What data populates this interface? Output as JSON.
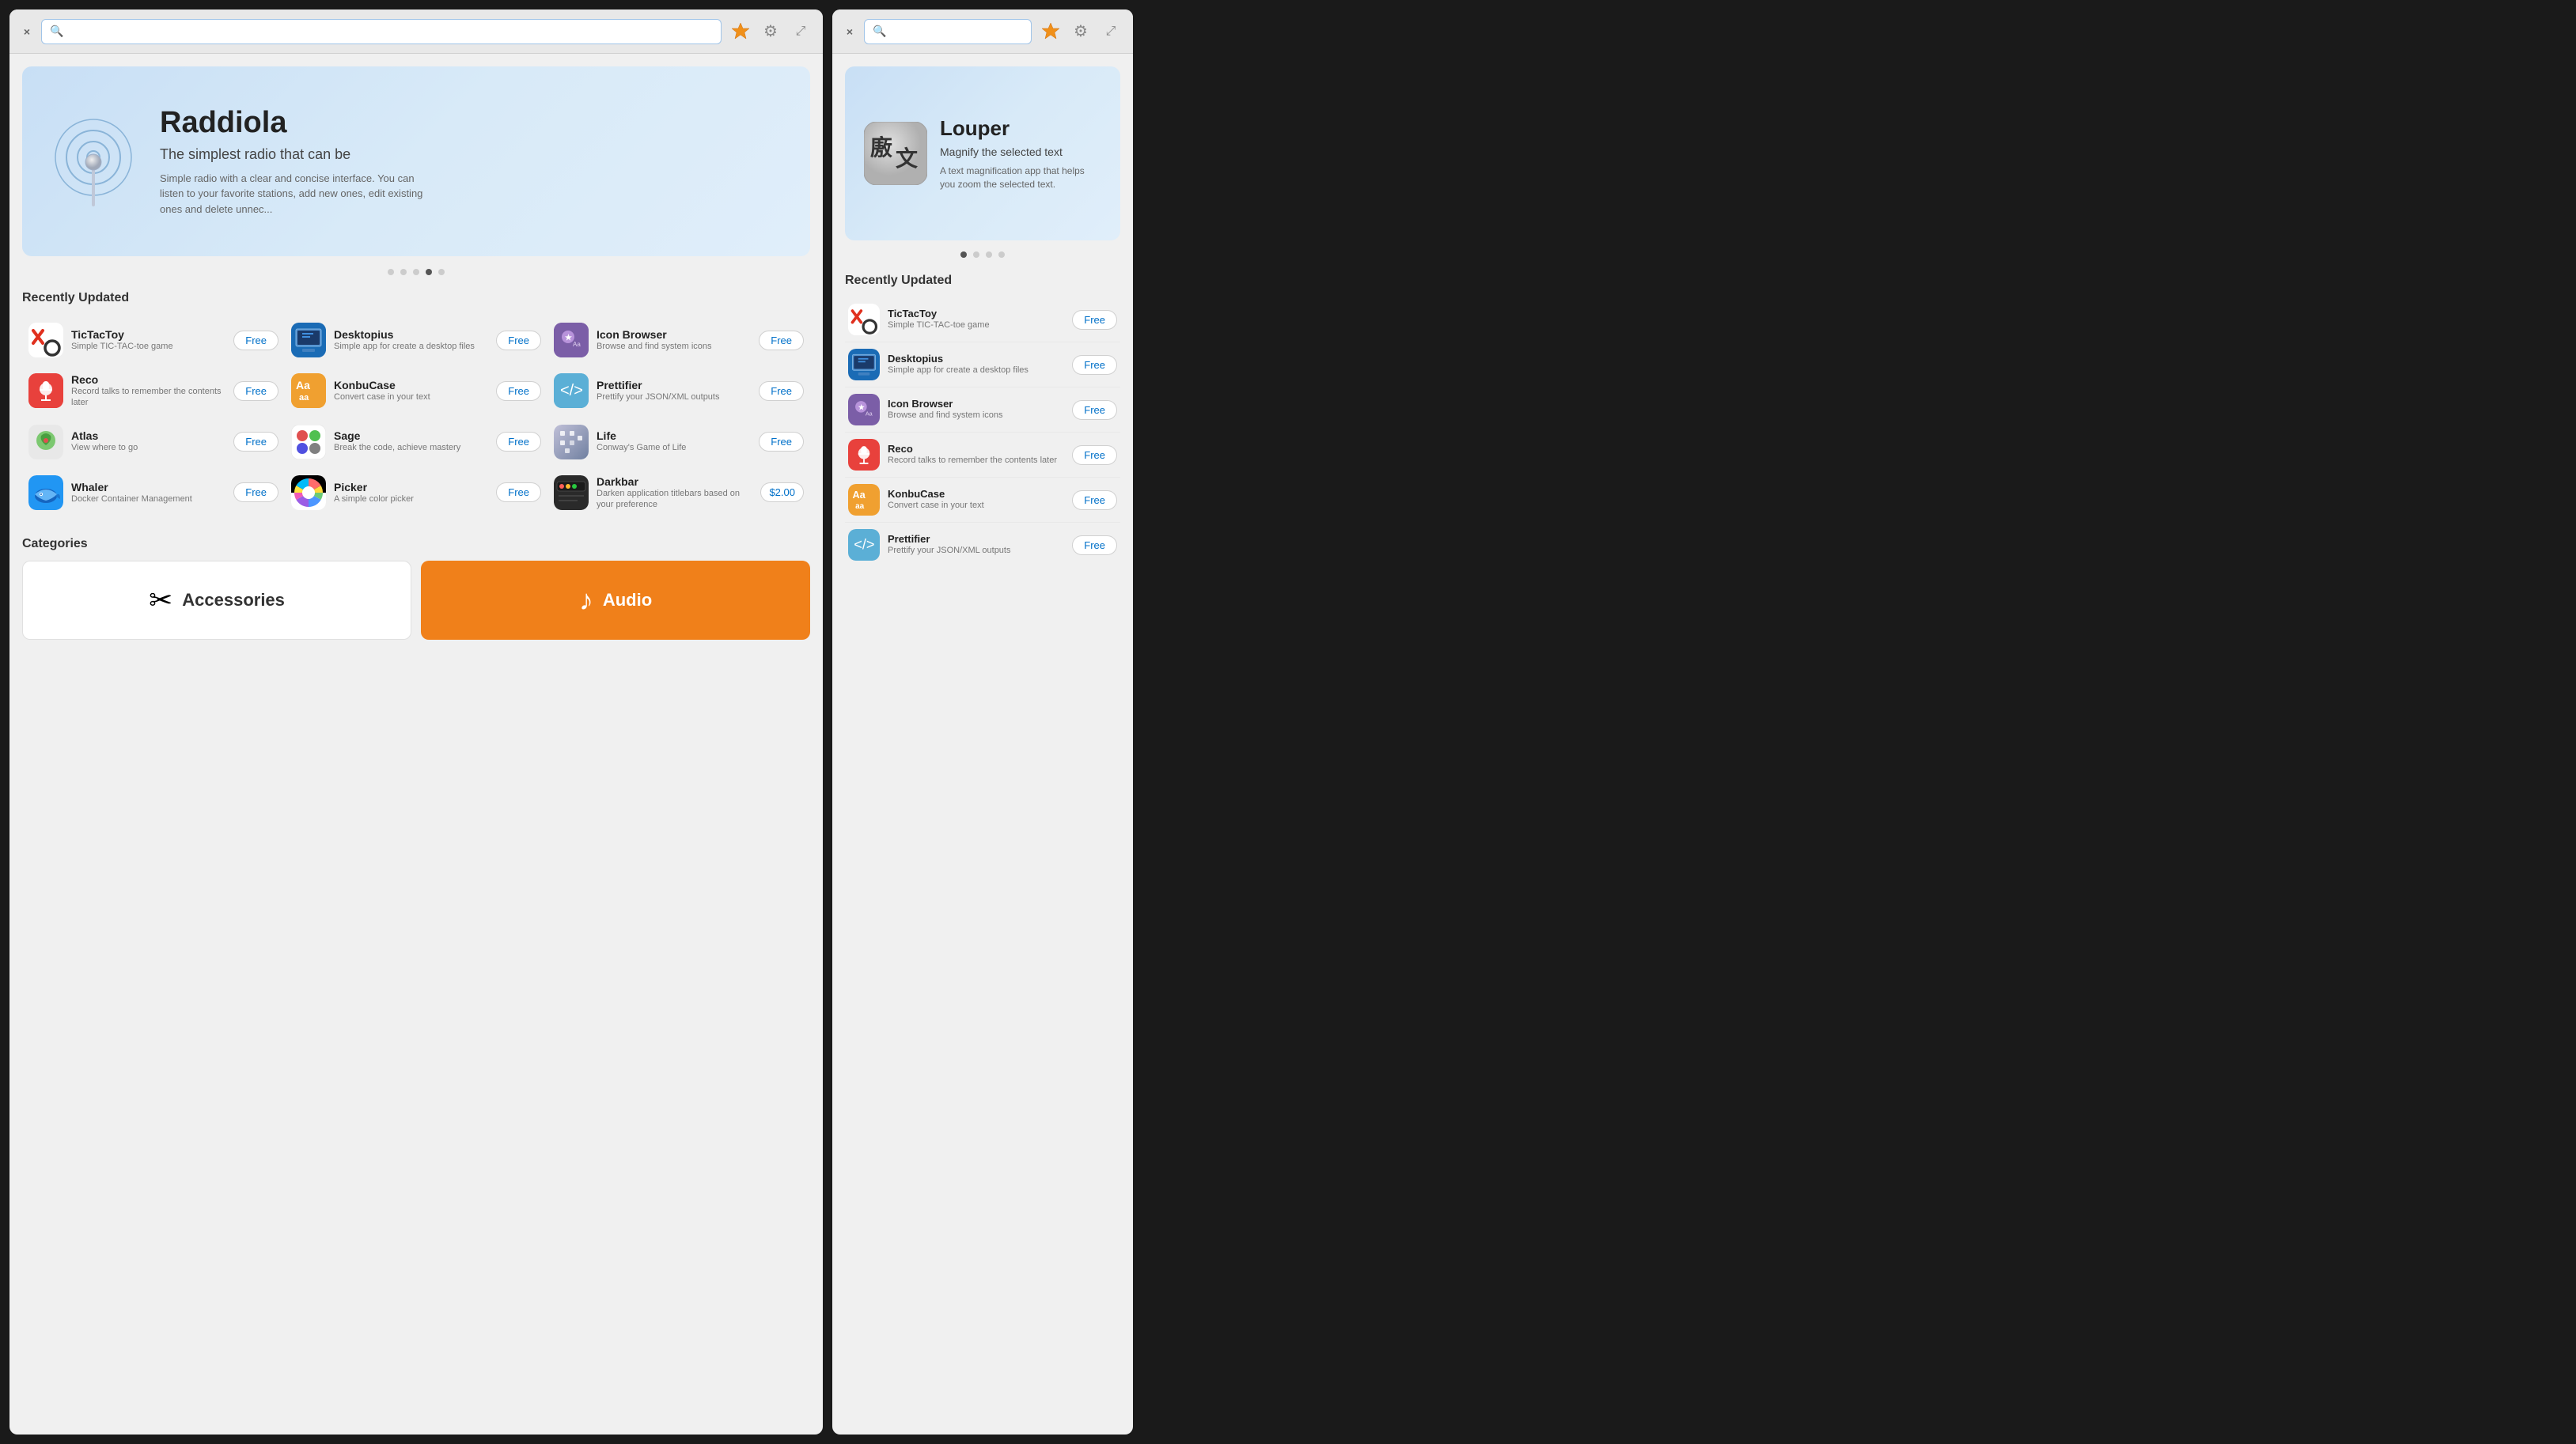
{
  "window_left": {
    "close_btn": "×",
    "search_placeholder": "",
    "titlebar_icons": {
      "badge": "🔶",
      "gear": "⚙",
      "expand": "⤢"
    },
    "hero": {
      "title": "Raddiola",
      "subtitle": "The simplest radio that can be",
      "description": "Simple radio with a clear and concise interface. You can listen to your favorite stations, add new ones, edit existing ones and delete unnec...",
      "dots": [
        false,
        false,
        false,
        true,
        false
      ]
    },
    "recently_updated_label": "Recently Updated",
    "apps": [
      {
        "name": "TicTacToy",
        "desc": "Simple TIC-TAC-toe game",
        "price": "Free",
        "icon_type": "tictactoe"
      },
      {
        "name": "Desktopius",
        "desc": "Simple app for create a desktop files",
        "price": "Free",
        "icon_type": "desktopius"
      },
      {
        "name": "Icon Browser",
        "desc": "Browse and find system icons",
        "price": "Free",
        "icon_type": "iconbrowser"
      },
      {
        "name": "Reco",
        "desc": "Record talks to remember the contents later",
        "price": "Free",
        "icon_type": "reco"
      },
      {
        "name": "KonbuCase",
        "desc": "Convert case in your text",
        "price": "Free",
        "icon_type": "konbucase"
      },
      {
        "name": "Prettifier",
        "desc": "Prettify your JSON/XML outputs",
        "price": "Free",
        "icon_type": "prettifier"
      },
      {
        "name": "Atlas",
        "desc": "View where to go",
        "price": "Free",
        "icon_type": "atlas"
      },
      {
        "name": "Sage",
        "desc": "Break the code, achieve mastery",
        "price": "Free",
        "icon_type": "sage"
      },
      {
        "name": "Life",
        "desc": "Conway's Game of Life",
        "price": "Free",
        "icon_type": "life"
      },
      {
        "name": "Whaler",
        "desc": "Docker Container Management",
        "price": "Free",
        "icon_type": "whaler"
      },
      {
        "name": "Picker",
        "desc": "A simple color picker",
        "price": "Free",
        "icon_type": "picker"
      },
      {
        "name": "Darkbar",
        "desc": "Darken application titlebars based on your preference",
        "price": "$2.00",
        "icon_type": "darkbar"
      }
    ],
    "categories_label": "Categories",
    "categories": [
      {
        "name": "Accessories",
        "type": "accessories",
        "icon": "✂"
      },
      {
        "name": "Audio",
        "type": "audio",
        "icon": "♪"
      }
    ]
  },
  "window_right": {
    "close_btn": "×",
    "search_placeholder": "",
    "titlebar_icons": {
      "badge": "🔶",
      "gear": "⚙",
      "expand": "⤢"
    },
    "hero": {
      "title": "Louper",
      "subtitle": "Magnify the selected text",
      "description": "A text magnification app that helps you zoom the selected text.",
      "dots": [
        true,
        false,
        false,
        false
      ]
    },
    "recently_updated_label": "Recently Updated",
    "apps": [
      {
        "name": "TicTacToy",
        "desc": "Simple TIC-TAC-toe game",
        "price": "Free",
        "icon_type": "tictactoe"
      },
      {
        "name": "Desktopius",
        "desc": "Simple app for create a desktop files",
        "price": "Free",
        "icon_type": "desktopius"
      },
      {
        "name": "Icon Browser",
        "desc": "Browse and find system icons",
        "price": "Free",
        "icon_type": "iconbrowser"
      },
      {
        "name": "Reco",
        "desc": "Record talks to remember the contents later",
        "price": "Free",
        "icon_type": "reco"
      },
      {
        "name": "KonbuCase",
        "desc": "Convert case in your text",
        "price": "Free",
        "icon_type": "konbucase"
      },
      {
        "name": "Prettifier",
        "desc": "Prettify your JSON/XML outputs",
        "price": "Free",
        "icon_type": "prettifier"
      }
    ]
  }
}
